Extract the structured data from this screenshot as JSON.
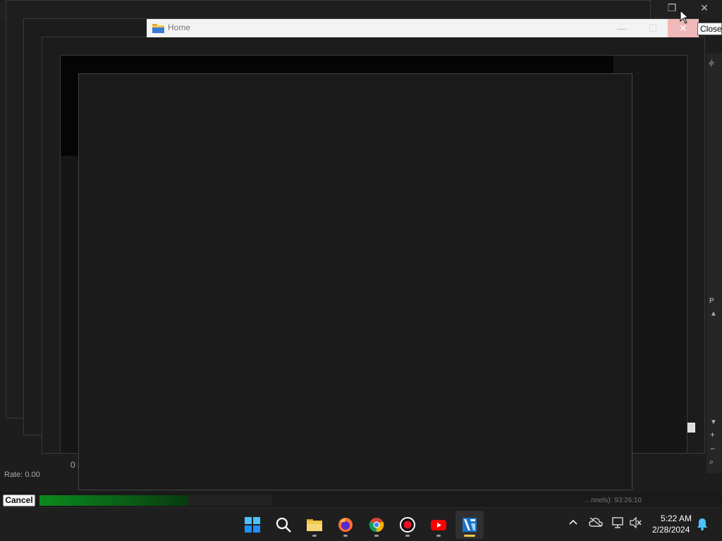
{
  "explorer": {
    "title": "Home"
  },
  "tooltip": {
    "text": "Close"
  },
  "status": {
    "rate": "Rate: 0.00",
    "cancel_label": "Cancel",
    "channels_text": "...nnels): 93:26:10",
    "left_fragment": "0 i",
    "progress_percent": 64
  },
  "taskbar": {
    "items": [
      {
        "name": "start",
        "icon": "windows-logo-icon"
      },
      {
        "name": "search",
        "icon": "search-icon"
      },
      {
        "name": "file-explorer",
        "icon": "folder-icon"
      },
      {
        "name": "firefox",
        "icon": "firefox-icon"
      },
      {
        "name": "chrome",
        "icon": "chrome-icon"
      },
      {
        "name": "screen-recorder",
        "icon": "record-icon"
      },
      {
        "name": "youtube",
        "icon": "youtube-icon"
      },
      {
        "name": "video-editor",
        "icon": "video-editor-icon",
        "active": true
      }
    ],
    "clock_time": "5:22 AM",
    "clock_date": "2/28/2024"
  },
  "colors": {
    "accent": "#f2c94c",
    "progress": "#0b8a1d",
    "close_hover": "#f0b8b8"
  }
}
